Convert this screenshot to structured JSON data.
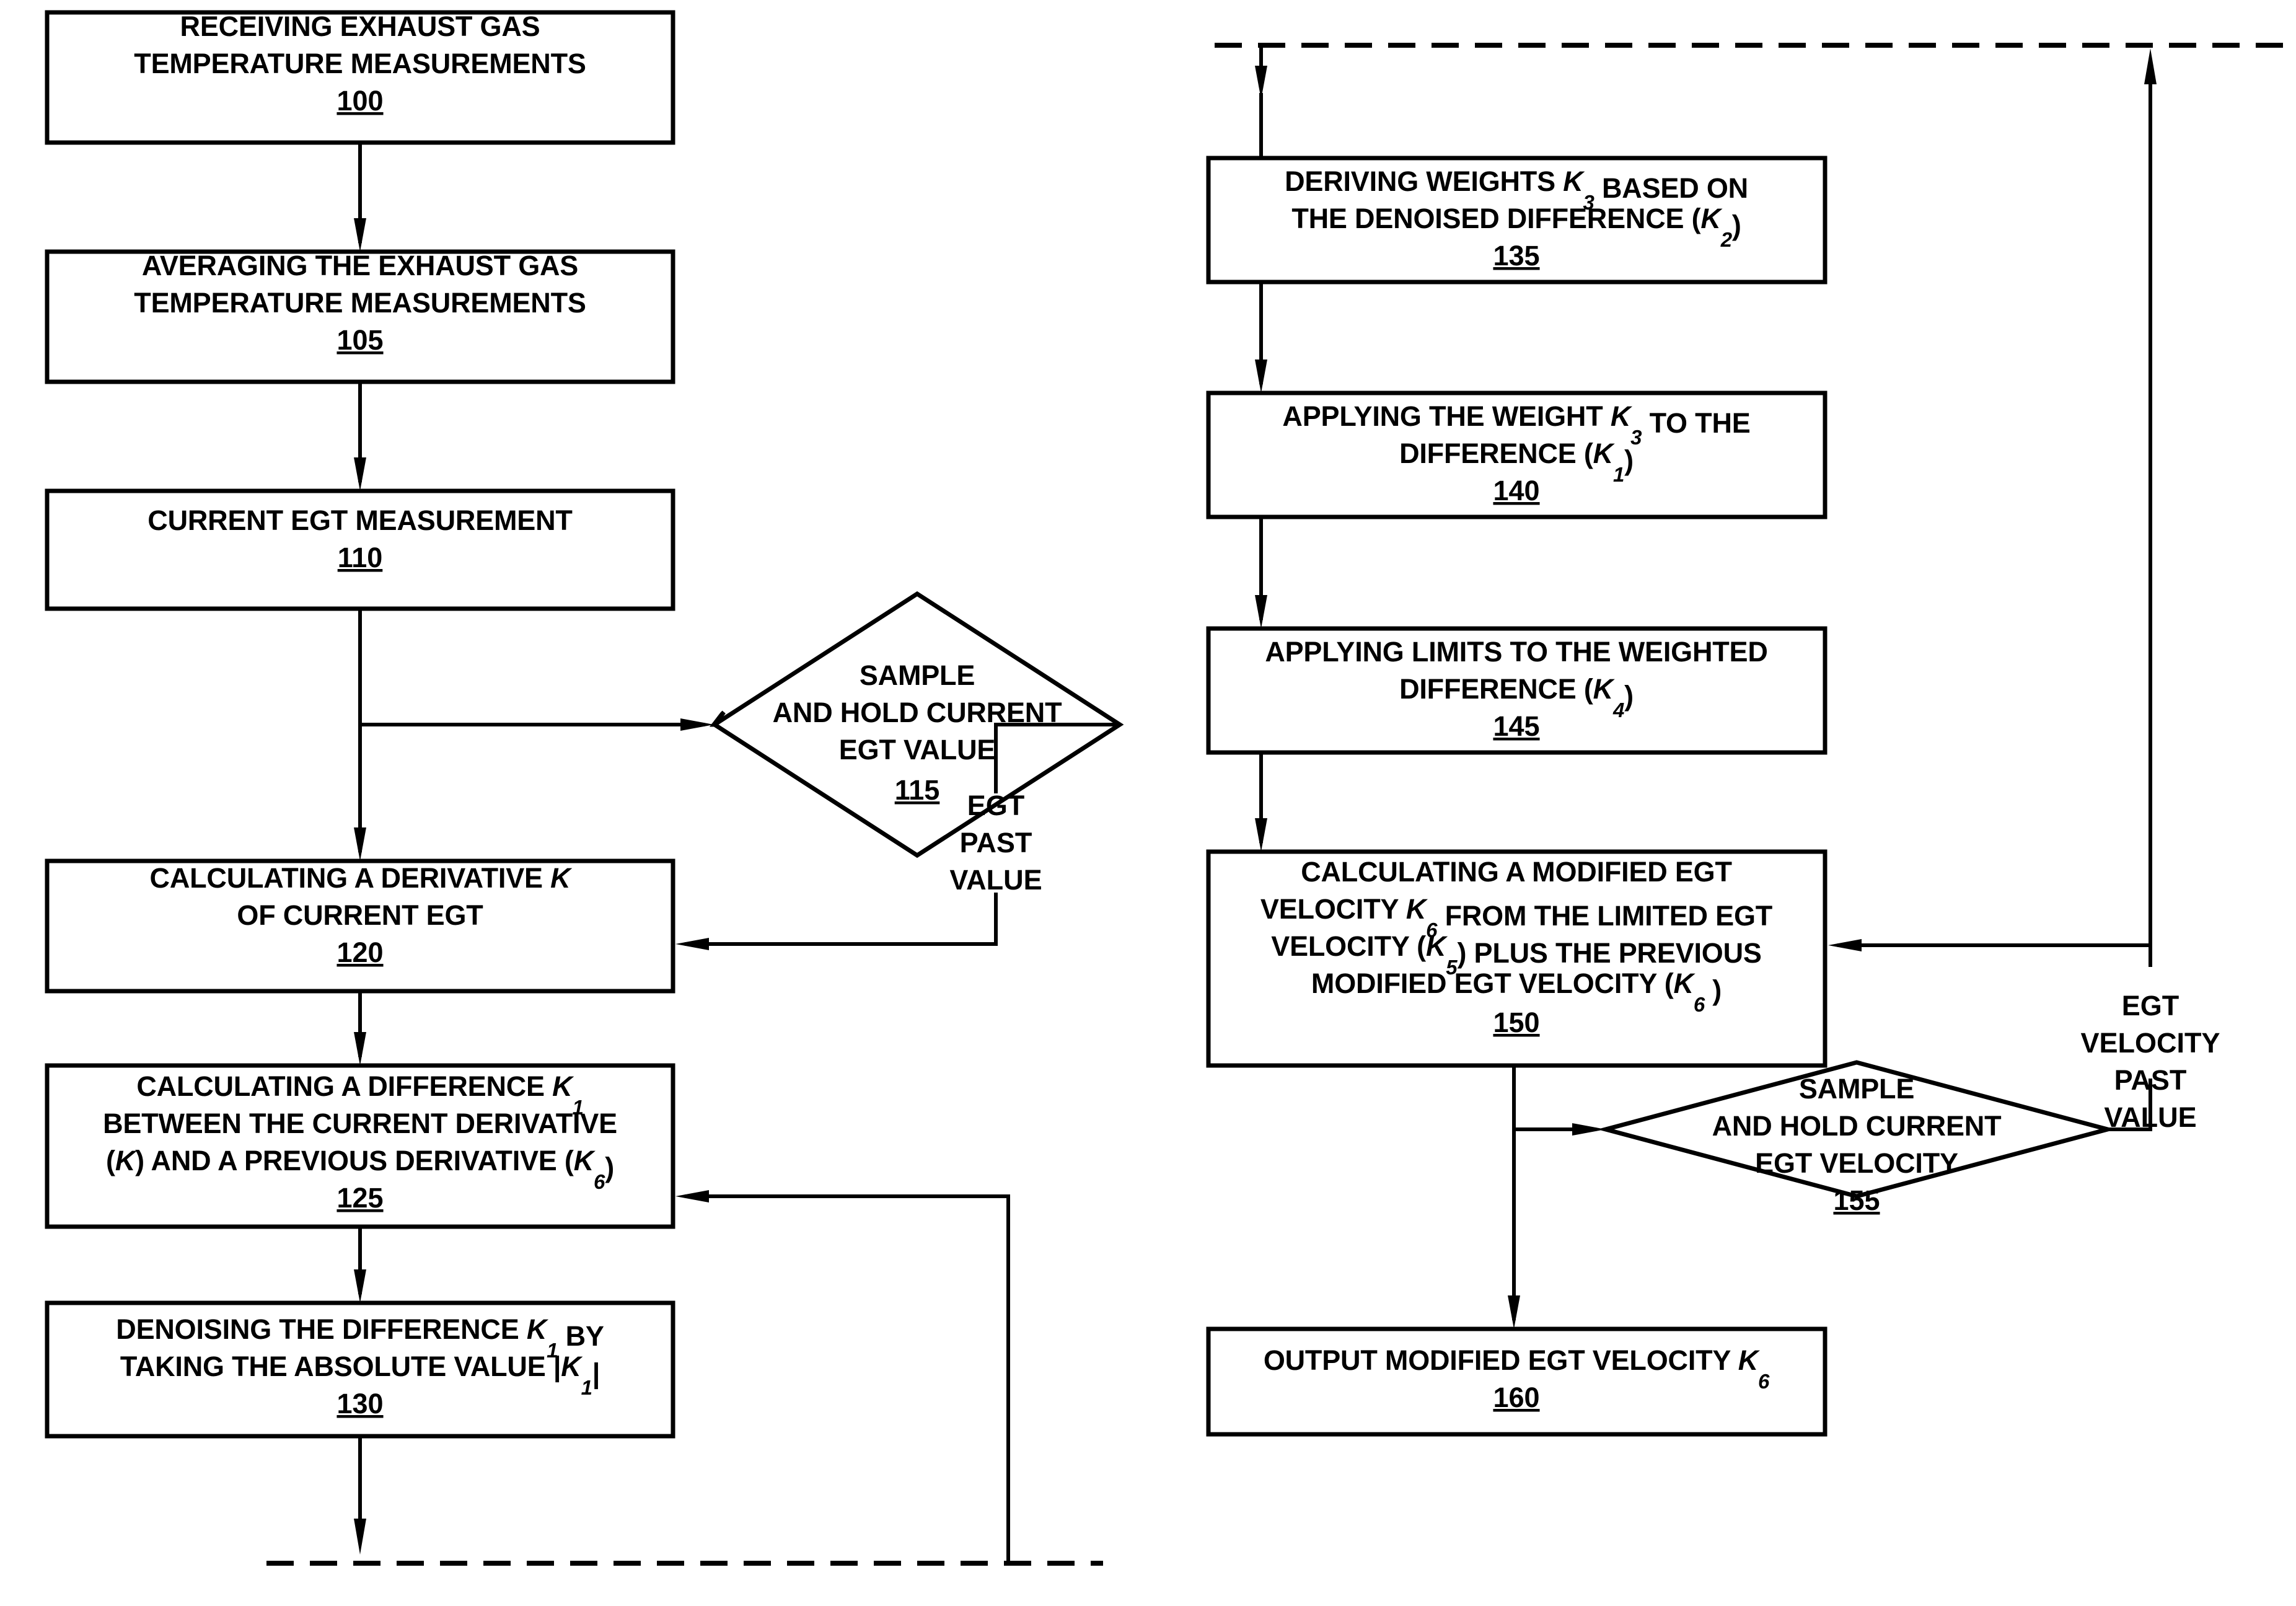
{
  "figure": {
    "type": "process-flowchart",
    "orientation": "two-column",
    "line_color": "#000000",
    "background_color": "#ffffff"
  },
  "nodes": [
    {
      "id": "n100",
      "shape": "rectangle",
      "ref": "100",
      "lines": [
        [
          {
            "t": "RECEIVING EXHAUST GAS"
          }
        ],
        [
          {
            "t": "TEMPERATURE MEASUREMENTS"
          }
        ]
      ]
    },
    {
      "id": "n105",
      "shape": "rectangle",
      "ref": "105",
      "lines": [
        [
          {
            "t": "AVERAGING THE EXHAUST GAS"
          }
        ],
        [
          {
            "t": "TEMPERATURE MEASUREMENTS"
          }
        ]
      ]
    },
    {
      "id": "n110",
      "shape": "rectangle",
      "ref": "110",
      "lines": [
        [
          {
            "t": "CURRENT EGT MEASUREMENT"
          }
        ]
      ]
    },
    {
      "id": "n115",
      "shape": "diamond",
      "ref": "115",
      "lines": [
        [
          {
            "t": "SAMPLE"
          }
        ],
        [
          {
            "t": "AND HOLD CURRENT"
          }
        ],
        [
          {
            "t": "EGT VALUE"
          }
        ]
      ]
    },
    {
      "id": "n120",
      "shape": "rectangle",
      "ref": "120",
      "lines": [
        [
          {
            "t": "CALCULATING A DERIVATIVE "
          },
          {
            "t": "K",
            "i": true
          }
        ],
        [
          {
            "t": "OF CURRENT EGT"
          }
        ]
      ]
    },
    {
      "id": "n125",
      "shape": "rectangle",
      "ref": "125",
      "lines": [
        [
          {
            "t": "CALCULATING A DIFFERENCE "
          },
          {
            "t": "K",
            "i": true
          },
          {
            "t": "1",
            "i": true,
            "sub": true
          }
        ],
        [
          {
            "t": "BETWEEN THE CURRENT DERIVATIVE"
          }
        ],
        [
          {
            "t": "("
          },
          {
            "t": "K",
            "i": true
          },
          {
            "t": ") AND A PREVIOUS DERIVATIVE ("
          },
          {
            "t": "K",
            "i": true
          },
          {
            "t": "6",
            "i": true,
            "sub": true
          },
          {
            "t": ")"
          }
        ]
      ]
    },
    {
      "id": "n130",
      "shape": "rectangle",
      "ref": "130",
      "lines": [
        [
          {
            "t": "DENOISING THE DIFFERENCE "
          },
          {
            "t": "K",
            "i": true
          },
          {
            "t": "1",
            "i": true,
            "sub": true
          },
          {
            "t": " BY"
          }
        ],
        [
          {
            "t": "TAKING THE ABSOLUTE VALUE |"
          },
          {
            "t": "K",
            "i": true
          },
          {
            "t": "1",
            "i": true,
            "sub": true
          },
          {
            "t": "|"
          }
        ]
      ]
    },
    {
      "id": "n135",
      "shape": "rectangle",
      "ref": "135",
      "lines": [
        [
          {
            "t": "DERIVING WEIGHTS "
          },
          {
            "t": "K",
            "i": true
          },
          {
            "t": "3",
            "i": true,
            "sub": true
          },
          {
            "t": " BASED ON"
          }
        ],
        [
          {
            "t": "THE DENOISED DIFFERENCE  ("
          },
          {
            "t": "K",
            "i": true
          },
          {
            "t": "2",
            "i": true,
            "sub": true
          },
          {
            "t": ")"
          }
        ]
      ]
    },
    {
      "id": "n140",
      "shape": "rectangle",
      "ref": "140",
      "lines": [
        [
          {
            "t": "APPLYING THE WEIGHT "
          },
          {
            "t": "K",
            "i": true
          },
          {
            "t": "3",
            "i": true,
            "sub": true
          },
          {
            "t": " TO THE"
          }
        ],
        [
          {
            "t": "DIFFERENCE  ("
          },
          {
            "t": "K",
            "i": true
          },
          {
            "t": "1",
            "i": true,
            "sub": true
          },
          {
            "t": ")"
          }
        ]
      ]
    },
    {
      "id": "n145",
      "shape": "rectangle",
      "ref": "145",
      "lines": [
        [
          {
            "t": "APPLYING LIMITS TO THE WEIGHTED"
          }
        ],
        [
          {
            "t": "DIFFERENCE  ("
          },
          {
            "t": "K",
            "i": true
          },
          {
            "t": "4",
            "i": true,
            "sub": true
          },
          {
            "t": ")"
          }
        ]
      ]
    },
    {
      "id": "n150",
      "shape": "rectangle",
      "ref": "150",
      "lines": [
        [
          {
            "t": "CALCULATING A MODIFIED EGT"
          }
        ],
        [
          {
            "t": "VELOCITY "
          },
          {
            "t": "K",
            "i": true
          },
          {
            "t": "6",
            "i": true,
            "sub": true
          },
          {
            "t": " FROM THE LIMITED EGT"
          }
        ],
        [
          {
            "t": "VELOCITY ("
          },
          {
            "t": "K",
            "i": true
          },
          {
            "t": "5",
            "i": true,
            "sub": true
          },
          {
            "t": ") PLUS THE PREVIOUS"
          }
        ],
        [
          {
            "t": "MODIFIED EGT VELOCITY ("
          },
          {
            "t": "K",
            "i": true
          },
          {
            "t": "6",
            "i": true,
            "sub": true
          },
          {
            "t": " )"
          }
        ]
      ]
    },
    {
      "id": "n155",
      "shape": "diamond",
      "ref": "155",
      "lines": [
        [
          {
            "t": "SAMPLE"
          }
        ],
        [
          {
            "t": "AND HOLD CURRENT"
          }
        ],
        [
          {
            "t": "EGT VELOCITY"
          }
        ]
      ]
    },
    {
      "id": "n160",
      "shape": "rectangle",
      "ref": "160",
      "lines": [
        [
          {
            "t": "OUTPUT MODIFIED EGT VELOCITY "
          },
          {
            "t": "K",
            "i": true
          },
          {
            "t": "6",
            "i": true,
            "sub": true
          }
        ]
      ]
    }
  ],
  "edge_labels": {
    "egt_past_value": [
      "EGT",
      "PAST",
      "VALUE"
    ],
    "egt_velocity_past_value": [
      "EGT",
      "VELOCITY",
      "PAST",
      "VALUE"
    ]
  }
}
